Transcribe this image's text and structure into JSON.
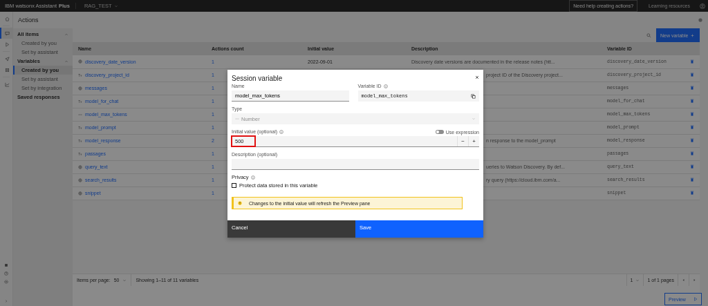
{
  "top_bar": {
    "brand": "IBM watsonx Assistant",
    "tier": "Plus",
    "project": "RAG_TEST",
    "help_button": "Need help creating actions?",
    "learning_link": "Learning resources"
  },
  "rail": [
    {
      "kind": "home",
      "selected": false
    },
    {
      "kind": "actions",
      "selected": true
    },
    {
      "kind": "preview",
      "selected": false
    },
    {
      "kind": "publish",
      "selected": false
    },
    {
      "kind": "environments",
      "selected": false
    },
    {
      "kind": "analytics",
      "selected": false
    }
  ],
  "page_title": "Actions",
  "sidebar": {
    "items": [
      {
        "label": "All items",
        "expanded": true,
        "children": [
          {
            "label": "Created by you",
            "selected": false
          },
          {
            "label": "Set by assistant",
            "selected": false
          }
        ]
      },
      {
        "label": "Variables",
        "expanded": true,
        "children": [
          {
            "label": "Created by you",
            "selected": true
          },
          {
            "label": "Set by assistant",
            "selected": false
          },
          {
            "label": "Set by integration",
            "selected": false
          }
        ]
      },
      {
        "label": "Saved responses",
        "expanded": false
      }
    ]
  },
  "toolbar": {
    "new_button": "New variable"
  },
  "table": {
    "columns": [
      "Name",
      "Actions count",
      "Initial value",
      "Description",
      "Variable ID"
    ],
    "rows": [
      {
        "kind": "json",
        "name": "discovery_date_version",
        "count": "1",
        "initial": "2022-09-01",
        "description": "Discovery date versions are documented in the release notes (htt...",
        "id": "discovery_date_version"
      },
      {
        "kind": "string",
        "name": "discovery_project_id",
        "count": "1",
        "description": "project ID of the Discovery project...",
        "id": "discovery_project_id"
      },
      {
        "kind": "json",
        "name": "messages",
        "count": "1",
        "id": "messages"
      },
      {
        "kind": "string",
        "name": "model_for_chat",
        "count": "1",
        "id": "model_for_chat"
      },
      {
        "kind": "number",
        "name": "model_max_tokens",
        "count": "1",
        "id": "model_max_tokens"
      },
      {
        "kind": "string",
        "name": "model_prompt",
        "count": "1",
        "id": "model_prompt"
      },
      {
        "kind": "string",
        "name": "model_response",
        "count": "2",
        "description": "n response to the model_prompt",
        "id": "model_response"
      },
      {
        "kind": "string",
        "name": "passages",
        "count": "1",
        "id": "passages"
      },
      {
        "kind": "json",
        "name": "query_text",
        "count": "1",
        "description": "ueries to Watson Discovery. By def...",
        "id": "query_text"
      },
      {
        "kind": "json",
        "name": "search_results",
        "count": "1",
        "description": "ry query (https://cloud.ibm.com/a...",
        "id": "search_results"
      },
      {
        "kind": "json",
        "name": "snippet",
        "count": "1",
        "id": "snippet"
      }
    ]
  },
  "pagination": {
    "items_label": "Items per page:",
    "per_page": "50",
    "showing": "Showing 1–11 of 11 variables",
    "page": "1",
    "pages": "1 of 1 pages"
  },
  "preview_button": "Preview",
  "modal": {
    "title": "Session variable",
    "name": {
      "label": "Name",
      "value": "model_max_tokens"
    },
    "variable_id": {
      "label": "Variable ID",
      "value": "model_max_tokens"
    },
    "type": {
      "label": "Type",
      "value": "Number",
      "disabled": true
    },
    "initial_value": {
      "label": "Initial value (optional)",
      "value": "500",
      "highlighted": true,
      "decrement": "−",
      "increment": "+"
    },
    "use_expression": {
      "label": "Use expression",
      "on": false
    },
    "description": {
      "label": "Description (optional)"
    },
    "privacy": {
      "label": "Privacy",
      "checkbox": "Protect data stored in this variable",
      "checked": false
    },
    "notice": "Changes to the initial value will refresh the Preview pane",
    "cancel": "Cancel",
    "save": "Save"
  }
}
